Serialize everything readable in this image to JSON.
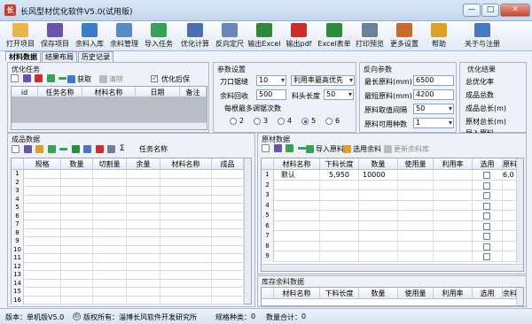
{
  "window": {
    "title": "长风型材优化软件V5.0(试用版)"
  },
  "toolbar": {
    "items": [
      {
        "label": "打开项目",
        "icon": "folder-open-icon",
        "color": "#e8b64a"
      },
      {
        "label": "保存项目",
        "icon": "save-icon",
        "color": "#6b54a8"
      },
      {
        "label": "余料入库",
        "icon": "stock-in-icon",
        "color": "#3c7bc9"
      },
      {
        "label": "余料管理",
        "icon": "stock-manage-icon",
        "color": "#5a8ac6"
      },
      {
        "label": "导入任务",
        "icon": "import-task-icon",
        "color": "#3aa055"
      },
      {
        "label": "优化计算",
        "icon": "optimize-icon",
        "color": "#4b6fb0"
      },
      {
        "label": "反向定尺",
        "icon": "reverse-size-icon",
        "color": "#6a87b8"
      },
      {
        "label": "输出Excel",
        "icon": "excel-export-icon",
        "color": "#2e8b3c"
      },
      {
        "label": "输出pdf",
        "icon": "pdf-export-icon",
        "color": "#c9302c"
      },
      {
        "label": "Excel表单",
        "icon": "excel-form-icon",
        "color": "#2e8b3c"
      },
      {
        "label": "打印预览",
        "icon": "print-preview-icon",
        "color": "#6e7f99"
      },
      {
        "label": "更多设置",
        "icon": "more-settings-icon",
        "color": "#c96a2a"
      },
      {
        "label": "帮助",
        "icon": "help-icon",
        "color": "#d9a227"
      },
      {
        "label": "关于与注册",
        "icon": "about-icon",
        "color": "#4a78c0"
      }
    ]
  },
  "tabs": [
    "材料数据",
    "结果布局",
    "历史记录"
  ],
  "optimize_task": {
    "title": "优化任务",
    "toolbar": {
      "get": "获取",
      "clear": "清除",
      "after_optimize": "优化后保"
    },
    "columns": [
      "id",
      "任务名称",
      "材料名称",
      "日期",
      "备注"
    ]
  },
  "params": {
    "title": "参数设置",
    "blade_label": "刀口锯缝",
    "blade_value": "10",
    "strategy": "利用率最高优先",
    "remnant_label": "余料回收",
    "remnant_value": "500",
    "head_label": "料头长度",
    "head_value": "50",
    "combo_label": "每根最多调锯次数",
    "options": [
      "2",
      "3",
      "4",
      "5",
      "6"
    ],
    "selected": "5"
  },
  "reverse": {
    "title": "反向参数",
    "max_label": "最长原料(mm)",
    "max_value": "6500",
    "min_label": "最短原料(mm)",
    "min_value": "4200",
    "interval_label": "原料取值间隔",
    "interval_value": "50",
    "kinds_label": "原料可用种数",
    "kinds_value": "1"
  },
  "results": {
    "title": "优化结果",
    "items": [
      "总优化率",
      "成品总数",
      "成品总长(m)",
      "原材总长(m)",
      "导入原料"
    ]
  },
  "product": {
    "title": "成品数据",
    "task_label": "任务名称",
    "columns": [
      "规格",
      "数量",
      "切割量",
      "余量",
      "材料名称",
      "成品"
    ],
    "rows": [
      "1",
      "2",
      "3",
      "4",
      "5",
      "6",
      "7",
      "8",
      "9",
      "10",
      "11",
      "12",
      "13",
      "14",
      "15",
      "16"
    ]
  },
  "raw": {
    "title": "原材数据",
    "import_label": "导入原料",
    "select_remnant": "选用余料",
    "update_remnant": "更新余料库",
    "columns": [
      "材料名称",
      "下料长度",
      "数量",
      "使用量",
      "利用率",
      "选用",
      "原料"
    ],
    "rows": [
      {
        "n": "1",
        "name": "默认",
        "length": "5,950",
        "qty": "10000",
        "extra": "6,0"
      },
      {
        "n": "2"
      },
      {
        "n": "3"
      },
      {
        "n": "4"
      },
      {
        "n": "5"
      },
      {
        "n": "6"
      },
      {
        "n": "7"
      },
      {
        "n": "8"
      },
      {
        "n": "9"
      }
    ]
  },
  "stock": {
    "title": "库存余料数据",
    "columns": [
      "材料名称",
      "下料长度",
      "数量",
      "使用量",
      "利用率",
      "选用",
      "余料"
    ]
  },
  "status": {
    "version": "版本：单机版V5.0",
    "copyright": "版权所有：淄博长风软件开发研究所",
    "spec_label": "规格种类：",
    "spec_value": "0",
    "sum_label": "数量合计：",
    "sum_value": "0"
  }
}
